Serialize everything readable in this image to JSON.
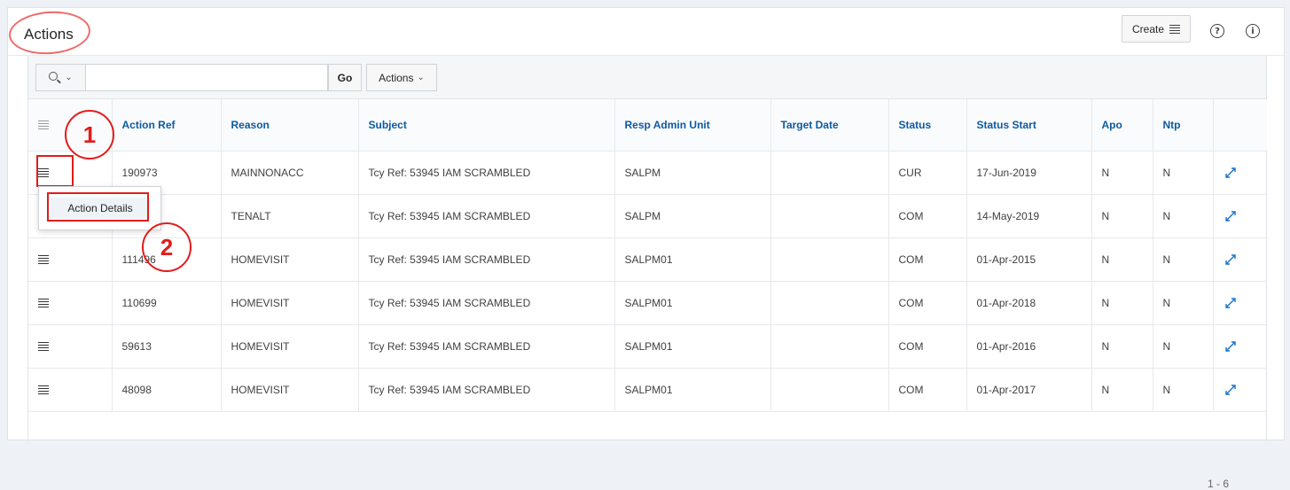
{
  "region": {
    "title": "Actions",
    "create_label": "Create",
    "help_icon": "?",
    "info_icon": "i"
  },
  "toolbar": {
    "search_placeholder": "",
    "search_value": "",
    "go_label": "Go",
    "actions_label": "Actions"
  },
  "table": {
    "columns": [
      "Action Ref",
      "Reason",
      "Subject",
      "Resp Admin Unit",
      "Target Date",
      "Status",
      "Status Start",
      "Apo",
      "Ntp"
    ],
    "rows": [
      {
        "ref": "190973",
        "reason": "MAINNONACC",
        "subject": "Tcy Ref: 53945 IAM SCRAMBLED",
        "unit": "SALPM",
        "target": "",
        "status": "CUR",
        "start": "17-Jun-2019",
        "apo": "N",
        "ntp": "N"
      },
      {
        "ref": "",
        "reason": "TENALT",
        "subject": "Tcy Ref: 53945 IAM SCRAMBLED",
        "unit": "SALPM",
        "target": "",
        "status": "COM",
        "start": "14-May-2019",
        "apo": "N",
        "ntp": "N"
      },
      {
        "ref": "111496",
        "reason": "HOMEVISIT",
        "subject": "Tcy Ref: 53945 IAM SCRAMBLED",
        "unit": "SALPM01",
        "target": "",
        "status": "COM",
        "start": "01-Apr-2015",
        "apo": "N",
        "ntp": "N"
      },
      {
        "ref": "110699",
        "reason": "HOMEVISIT",
        "subject": "Tcy Ref: 53945 IAM SCRAMBLED",
        "unit": "SALPM01",
        "target": "",
        "status": "COM",
        "start": "01-Apr-2018",
        "apo": "N",
        "ntp": "N"
      },
      {
        "ref": "59613",
        "reason": "HOMEVISIT",
        "subject": "Tcy Ref: 53945 IAM SCRAMBLED",
        "unit": "SALPM01",
        "target": "",
        "status": "COM",
        "start": "01-Apr-2016",
        "apo": "N",
        "ntp": "N"
      },
      {
        "ref": "48098",
        "reason": "HOMEVISIT",
        "subject": "Tcy Ref: 53945 IAM SCRAMBLED",
        "unit": "SALPM01",
        "target": "",
        "status": "COM",
        "start": "01-Apr-2017",
        "apo": "N",
        "ntp": "N"
      }
    ]
  },
  "row_menu": {
    "item_label": "Action Details"
  },
  "annotations": {
    "step1": "1",
    "step2": "2"
  },
  "pagination": "1 - 6",
  "colors": {
    "link_blue": "#0b5aa5",
    "annotation_red": "#e31b1b"
  }
}
